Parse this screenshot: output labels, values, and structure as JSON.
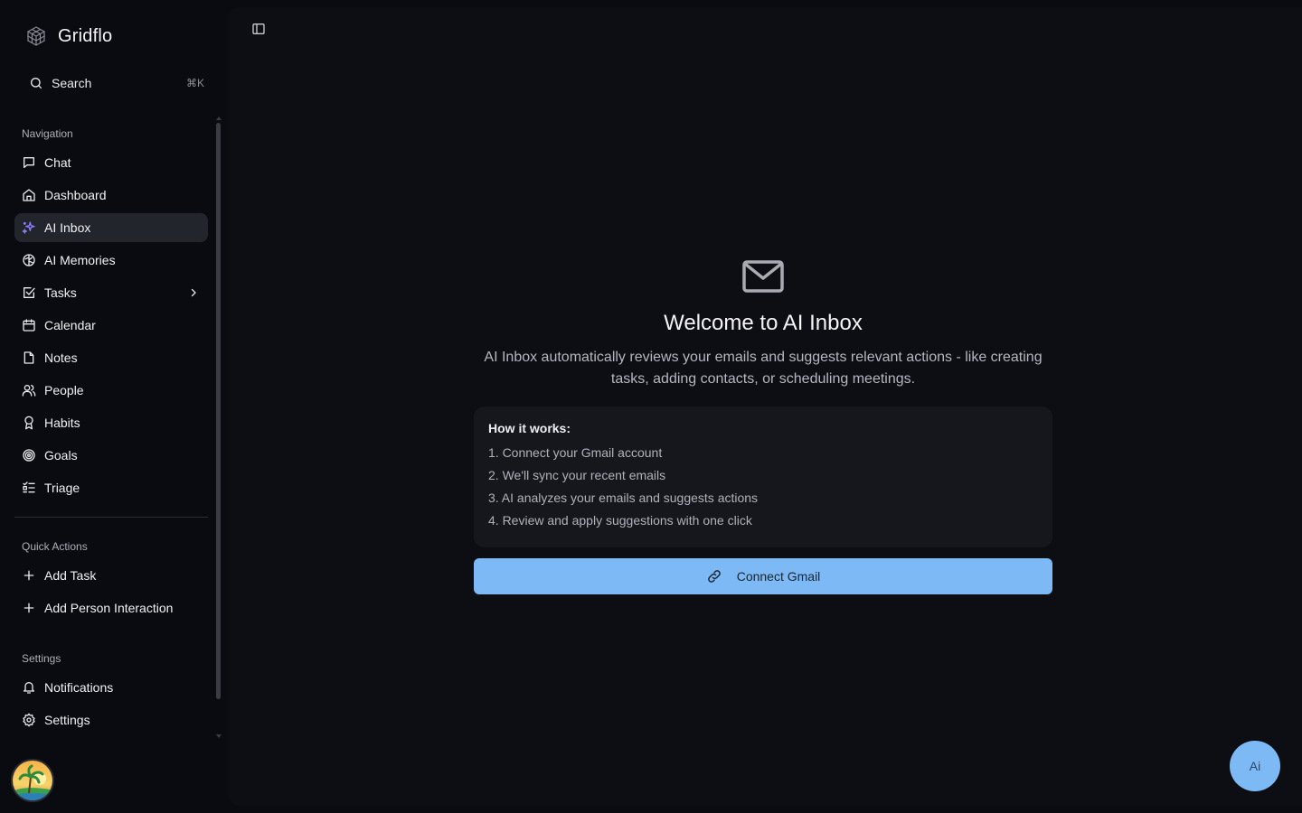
{
  "brand": {
    "name": "Gridflo"
  },
  "search": {
    "label": "Search",
    "shortcut": "⌘K"
  },
  "sections": {
    "navigation": "Navigation",
    "quick_actions": "Quick Actions",
    "settings": "Settings"
  },
  "nav_items": [
    {
      "label": "Chat",
      "icon": "chat-bubble-icon"
    },
    {
      "label": "Dashboard",
      "icon": "home-icon"
    },
    {
      "label": "AI Inbox",
      "icon": "sparkles-icon",
      "active": true
    },
    {
      "label": "AI Memories",
      "icon": "brain-icon"
    },
    {
      "label": "Tasks",
      "icon": "checkbox-icon",
      "has_chevron": true
    },
    {
      "label": "Calendar",
      "icon": "calendar-icon"
    },
    {
      "label": "Notes",
      "icon": "note-icon"
    },
    {
      "label": "People",
      "icon": "people-icon"
    },
    {
      "label": "Habits",
      "icon": "award-icon"
    },
    {
      "label": "Goals",
      "icon": "target-icon"
    },
    {
      "label": "Triage",
      "icon": "list-checks-icon"
    }
  ],
  "quick_actions": [
    {
      "label": "Add Task",
      "icon": "plus-icon"
    },
    {
      "label": "Add Person Interaction",
      "icon": "plus-icon"
    }
  ],
  "settings_items": [
    {
      "label": "Notifications",
      "icon": "bell-icon"
    },
    {
      "label": "Settings",
      "icon": "gear-icon"
    }
  ],
  "main": {
    "title": "Welcome to AI Inbox",
    "description": "AI Inbox automatically reviews your emails and suggests relevant actions - like creating tasks, adding contacts, or scheduling meetings.",
    "how_it_works": {
      "title": "How it works:",
      "steps": [
        "1. Connect your Gmail account",
        "2. We'll sync your recent emails",
        "3. AI analyzes your emails and suggests actions",
        "4. Review and apply suggestions with one click"
      ]
    },
    "connect_button": "Connect Gmail"
  },
  "ai_fab": {
    "label": "Ai"
  },
  "colors": {
    "accent": "#7cb9f5",
    "active_bg": "#23252d",
    "sparkle": "#8b7cf6"
  }
}
